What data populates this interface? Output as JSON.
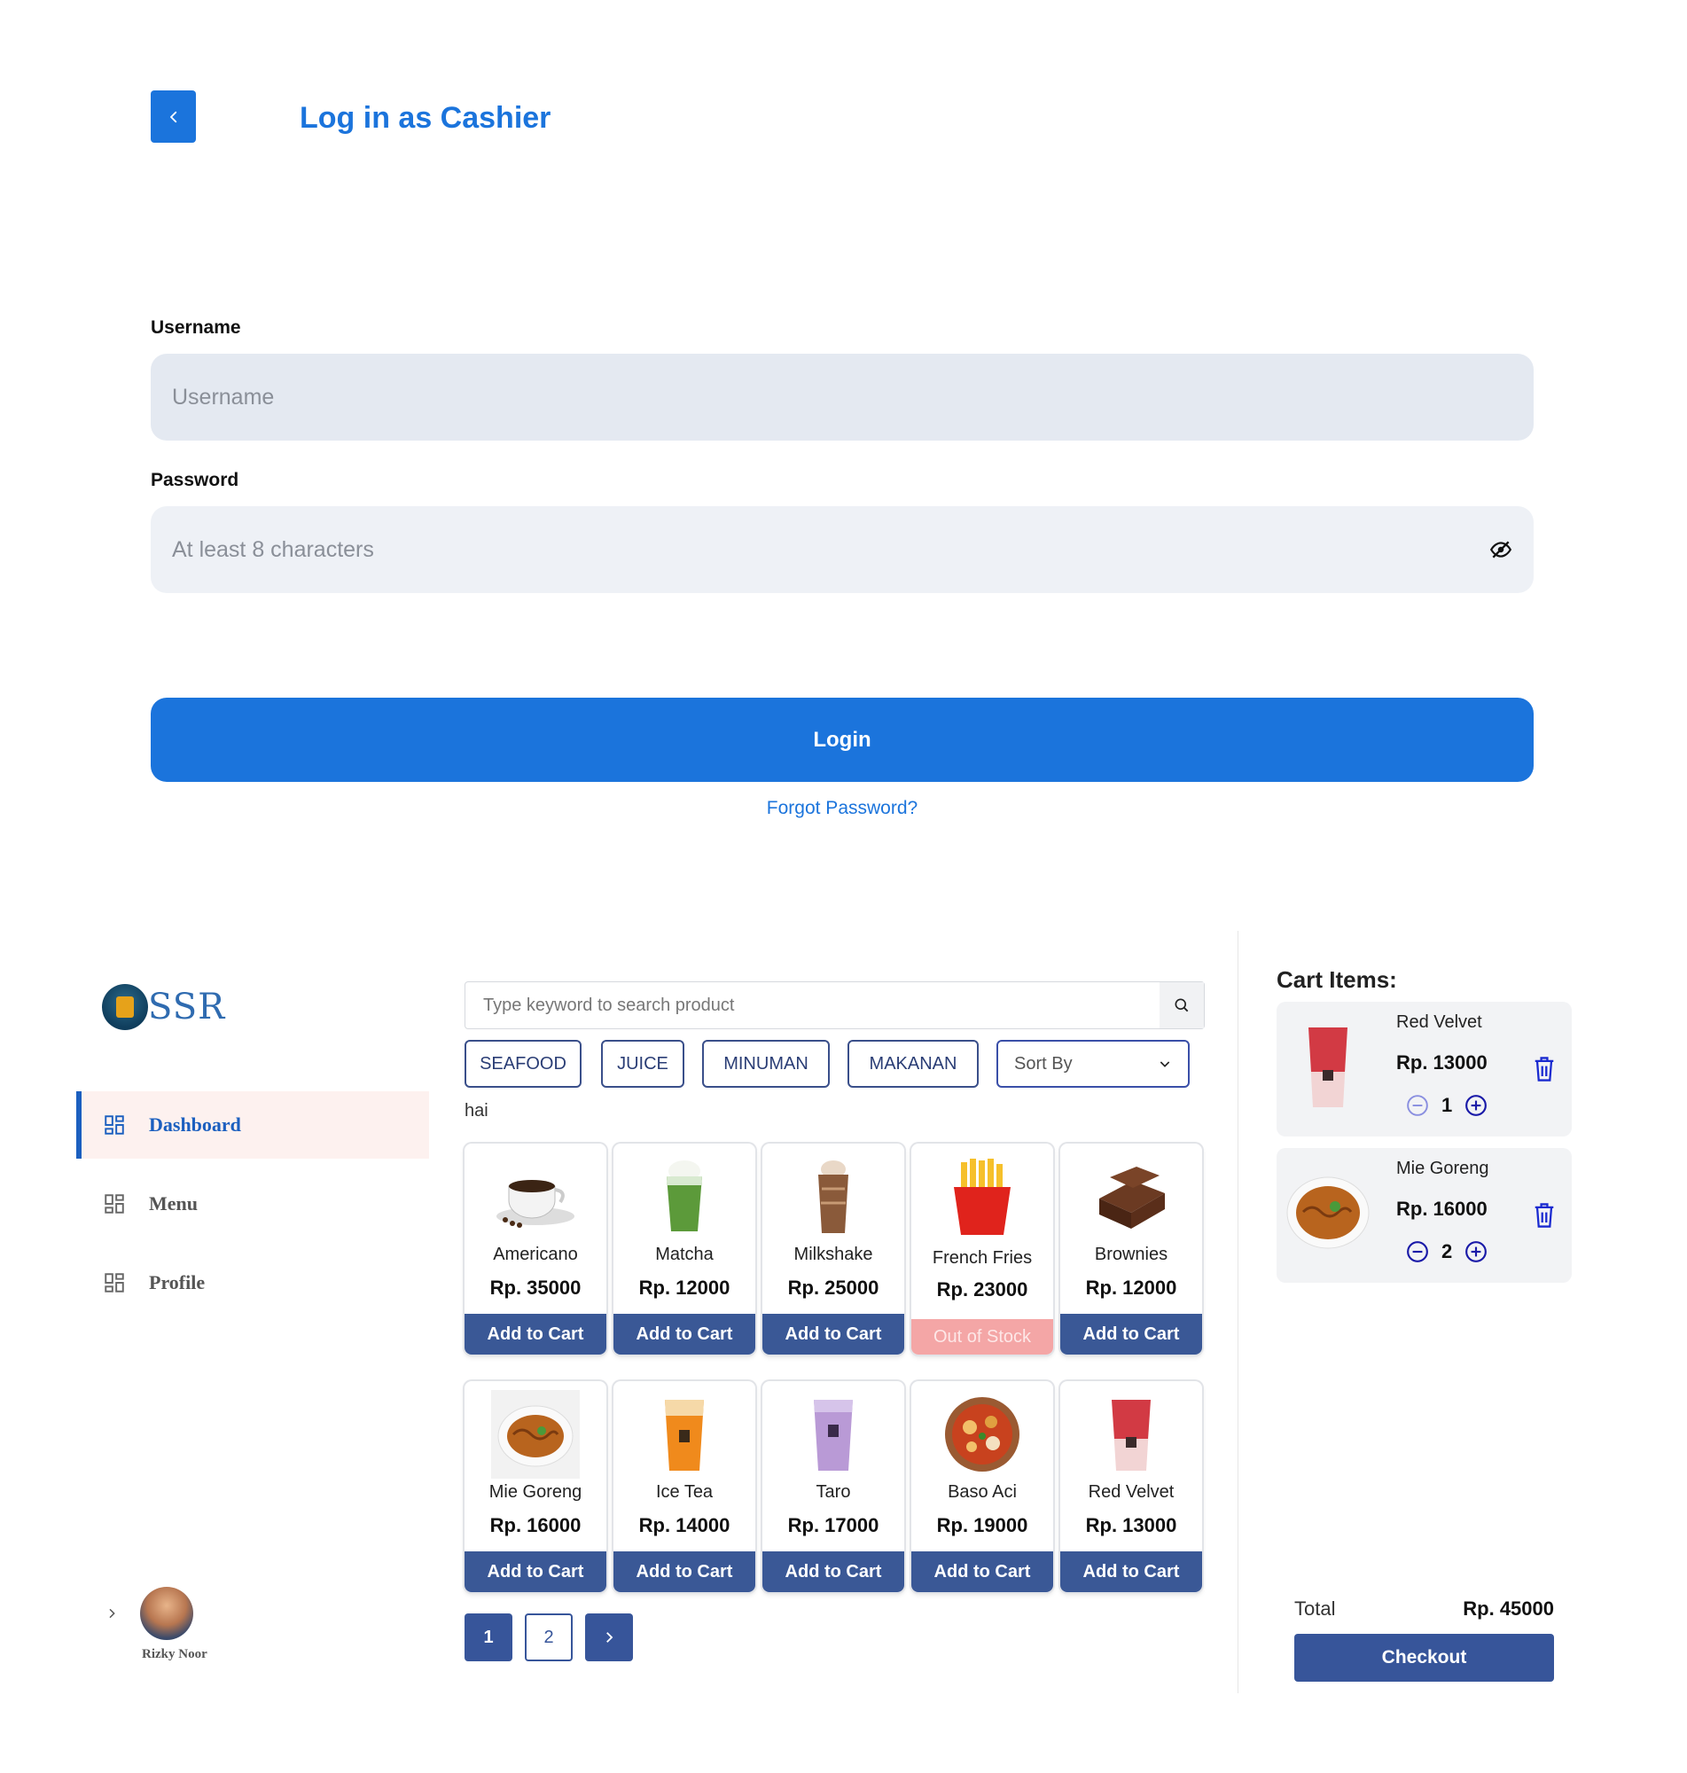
{
  "login": {
    "title": "Log in as Cashier",
    "username_label": "Username",
    "username_placeholder": "Username",
    "password_label": "Password",
    "password_placeholder": "At least 8 characters",
    "login_button": "Login",
    "forgot_link": "Forgot Password?"
  },
  "pos": {
    "logo_text": "SSR",
    "nav": [
      {
        "label": "Dashboard",
        "active": true
      },
      {
        "label": "Menu",
        "active": false
      },
      {
        "label": "Profile",
        "active": false
      }
    ],
    "user_name": "Rizky Noor",
    "search_placeholder": "Type keyword to search product",
    "categories": [
      "SEAFOOD",
      "JUICE",
      "MINUMAN",
      "MAKANAN"
    ],
    "sort_label": "Sort By",
    "greeting": "hai",
    "products": [
      {
        "name": "Americano",
        "price": "Rp. 35000",
        "button": "Add to Cart",
        "icon": "coffee-cup-icon"
      },
      {
        "name": "Matcha",
        "price": "Rp. 12000",
        "button": "Add to Cart",
        "icon": "matcha-drink-icon"
      },
      {
        "name": "Milkshake",
        "price": "Rp. 25000",
        "button": "Add to Cart",
        "icon": "milkshake-icon"
      },
      {
        "name": "French Fries",
        "price": "Rp. 23000",
        "button": "Out of Stock",
        "icon": "french-fries-icon"
      },
      {
        "name": "Brownies",
        "price": "Rp. 12000",
        "button": "Add to Cart",
        "icon": "brownies-icon"
      },
      {
        "name": "Mie Goreng",
        "price": "Rp. 16000",
        "button": "Add to Cart",
        "icon": "noodle-plate-icon"
      },
      {
        "name": "Ice Tea",
        "price": "Rp. 14000",
        "button": "Add to Cart",
        "icon": "ice-tea-icon"
      },
      {
        "name": "Taro",
        "price": "Rp. 17000",
        "button": "Add to Cart",
        "icon": "taro-drink-icon"
      },
      {
        "name": "Baso Aci",
        "price": "Rp. 19000",
        "button": "Add to Cart",
        "icon": "baso-aci-bowl-icon"
      },
      {
        "name": "Red Velvet",
        "price": "Rp. 13000",
        "button": "Add to Cart",
        "icon": "red-velvet-drink-icon"
      }
    ],
    "pages": [
      "1",
      "2"
    ],
    "cart": {
      "title": "Cart Items:",
      "items": [
        {
          "name": "Red Velvet",
          "price": "Rp. 13000",
          "qty": "1"
        },
        {
          "name": "Mie Goreng",
          "price": "Rp. 16000",
          "qty": "2"
        }
      ],
      "total_label": "Total",
      "total_value": "Rp. 45000",
      "checkout": "Checkout"
    }
  },
  "colors": {
    "primary_blue": "#1b74dc",
    "navy": "#37559a",
    "out_of_stock": "#f4a6a6",
    "input_bg": "#e4e9f1"
  }
}
